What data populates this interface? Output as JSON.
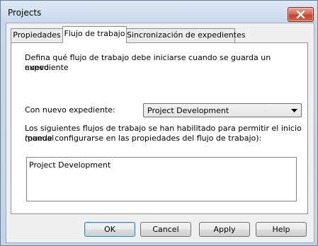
{
  "window": {
    "title": "Projects"
  },
  "tabs": [
    {
      "label": "Propiedades",
      "active": false
    },
    {
      "label": "Flujo de trabajo",
      "active": true
    },
    {
      "label": "Sincronización de expedientes",
      "active": false
    }
  ],
  "panel": {
    "intro_line1": "Defina qué flujo de trabajo debe iniciarse cuando se guarda un expediente",
    "intro_line2": "nuevo.",
    "new_doc_label": "Con nuevo expediente:",
    "workflow_select": {
      "value": "Project Development"
    },
    "manual_line1": "Los siguientes flujos de trabajo se han habilitado para permitir el inicio manual",
    "manual_line2": "(puede configurarse en las propiedades del flujo de trabajo):",
    "manual_workflows": [
      "Project Development"
    ]
  },
  "buttons": {
    "ok": "OK",
    "cancel": "Cancel",
    "apply": "Apply",
    "help": "Help"
  },
  "icons": {
    "close": "close-icon",
    "dropdown": "chevron-down-icon"
  }
}
